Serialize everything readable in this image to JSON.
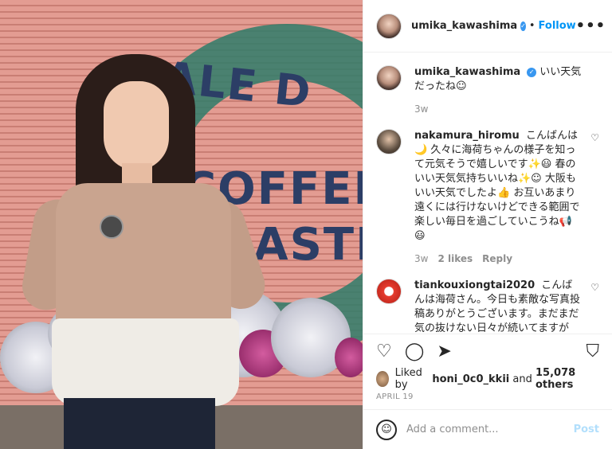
{
  "photo": {
    "sign": {
      "top": "ALE D",
      "mid": "COFFEE",
      "bot": "ROASTERS"
    }
  },
  "header": {
    "username": "umika_kawashima",
    "verified_glyph": "✓",
    "separator": "•",
    "follow_label": "Follow",
    "more_glyph": "•••"
  },
  "comments": [
    {
      "username": "umika_kawashima",
      "verified_glyph": "✓",
      "text": "いい天気だったね☺",
      "time": "3w"
    },
    {
      "username": "nakamura_hiromu",
      "text": "こんばんは🌙 久々に海荷ちゃんの様子を知って元気そうで嬉しいです✨😃 春のいい天気気持ちいいね✨☺ 大阪もいい天気でしたよ👍 お互いあまり遠くには行けないけどできる範囲で楽しい毎日を過ごしていこうね📢😃",
      "time": "3w",
      "likes": "2 likes",
      "reply": "Reply",
      "heart_glyph": "♡"
    },
    {
      "username": "tiankouxiongtai2020",
      "text": "こんばんは海荷さん。今日も素敵な写真投稿ありがとうございます。まだまだ気の抜けない日々が続いてますが",
      "heart_glyph": "♡"
    }
  ],
  "actions": {
    "like_glyph": "♡",
    "comment_glyph": "◯",
    "share_glyph": "➤",
    "save_glyph": "⛉"
  },
  "likes": {
    "prefix": "Liked by",
    "user": "honi_0c0_kkii",
    "mid": "and",
    "count": "15,078 others"
  },
  "date": "APRIL 19",
  "add_comment": {
    "emoji_glyph": "☺",
    "placeholder": "Add a comment...",
    "post_label": "Post"
  }
}
